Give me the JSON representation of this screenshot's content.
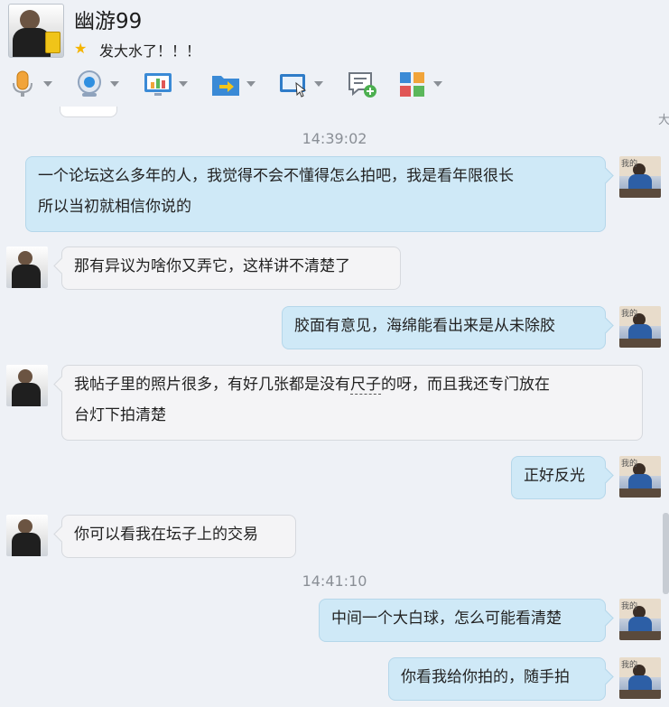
{
  "header": {
    "contact_name": "幽游99",
    "signature": "发大水了！！！",
    "star_icon": "star-icon"
  },
  "toolbar": {
    "items": [
      {
        "name": "microphone-icon"
      },
      {
        "name": "webcam-icon"
      },
      {
        "name": "screen-share-icon"
      },
      {
        "name": "file-transfer-icon"
      },
      {
        "name": "remote-assist-icon"
      },
      {
        "name": "new-message-icon"
      },
      {
        "name": "apps-grid-icon"
      }
    ]
  },
  "chat": {
    "messages": [
      {
        "type": "timestamp",
        "text": "14:39:02"
      },
      {
        "type": "me",
        "text_line1": "一个论坛这么多年的人，我觉得不会不懂得怎么拍吧，我是看年限很长",
        "text_line2": "所以当初就相信你说的"
      },
      {
        "type": "peer",
        "text": "那有异议为啥你又弄它，这样讲不清楚了"
      },
      {
        "type": "me",
        "text": "胶面有意见，海绵能看出来是从未除胶"
      },
      {
        "type": "peer",
        "text_pre": "我帖子里的照片很多，有好几张都是没有",
        "text_marked": "尺子",
        "text_post": "的呀，而且我还专门放在",
        "text_line2": "台灯下拍清楚"
      },
      {
        "type": "me",
        "text": "正好反光"
      },
      {
        "type": "peer",
        "text": "你可以看我在坛子上的交易"
      },
      {
        "type": "timestamp",
        "text": "14:41:10"
      },
      {
        "type": "me",
        "text": "中间一个大白球，怎么可能看清楚"
      },
      {
        "type": "me",
        "text": "你看我给你拍的，随手拍"
      }
    ],
    "scroll_glyph": "大",
    "avatar_label": "我的"
  },
  "colors": {
    "background": "#eef1f6",
    "my_bubble": "#cfe9f7",
    "peer_bubble": "#f4f4f6",
    "timestamp": "#8a8f96"
  }
}
